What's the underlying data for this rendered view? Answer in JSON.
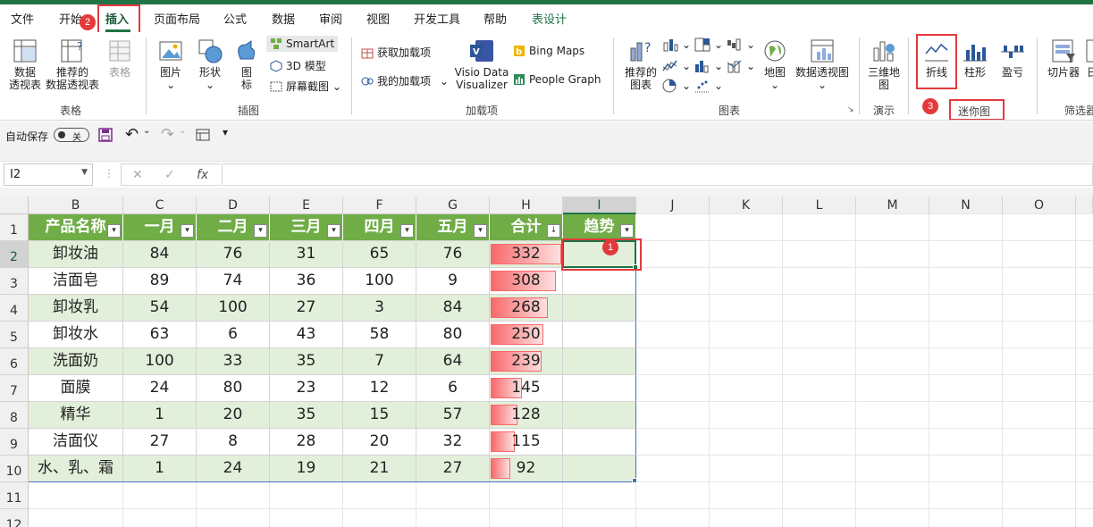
{
  "tabs": [
    "文件",
    "开始",
    "插入",
    "页面布局",
    "公式",
    "数据",
    "审阅",
    "视图",
    "开发工具",
    "帮助",
    "表设计"
  ],
  "active_tab": "插入",
  "ribbon": {
    "table_group": {
      "label": "表格",
      "pivot": "数据\n透视表",
      "pivot_l1": "数据",
      "pivot_l2": "透视表",
      "rec_l1": "推荐的",
      "rec_l2": "数据透视表",
      "table": "表格"
    },
    "illus_group": {
      "label": "插图",
      "pictures": "图片",
      "shapes": "形状",
      "icons_l1": "图",
      "icons_l2": "标",
      "smartart": "SmartArt",
      "model3d": "3D 模型",
      "screenshot": "屏幕截图"
    },
    "addins_group": {
      "label": "加载项",
      "get": "获取加载项",
      "my": "我的加载项",
      "visio_l1": "Visio Data",
      "visio_l2": "Visualizer",
      "bing": "Bing Maps",
      "people": "People Graph"
    },
    "charts_group": {
      "label": "图表",
      "rec_l1": "推荐的",
      "rec_l2": "图表",
      "map": "地图",
      "pivotchart": "数据透视图"
    },
    "tour_group": {
      "label": "演示",
      "map3d_l1": "三维地",
      "map3d_l2": "图"
    },
    "spark_group": {
      "label": "迷你图",
      "line": "折线",
      "column": "柱形",
      "winloss": "盈亏"
    },
    "filter_group": {
      "label": "筛选器",
      "slicer": "切片器",
      "timeline": "日"
    }
  },
  "qat": {
    "autosave": "自动保存",
    "toggle": "关"
  },
  "formula": {
    "namebox": "I2",
    "cancel": "✕",
    "enter": "✓",
    "fx": "fx",
    "value": ""
  },
  "columns": [
    "B",
    "C",
    "D",
    "E",
    "F",
    "G",
    "H",
    "I",
    "J",
    "K",
    "L",
    "M",
    "N",
    "O"
  ],
  "rows": [
    "1",
    "2",
    "3",
    "4",
    "5",
    "6",
    "7",
    "8",
    "9",
    "10",
    "11",
    "12"
  ],
  "table": {
    "headers": [
      "产品名称",
      "一月",
      "二月",
      "三月",
      "四月",
      "五月",
      "合计",
      "趋势"
    ],
    "rows": [
      [
        "卸妆油",
        "84",
        "76",
        "31",
        "65",
        "76",
        "332"
      ],
      [
        "洁面皂",
        "89",
        "74",
        "36",
        "100",
        "9",
        "308"
      ],
      [
        "卸妆乳",
        "54",
        "100",
        "27",
        "3",
        "84",
        "268"
      ],
      [
        "卸妆水",
        "63",
        "6",
        "43",
        "58",
        "80",
        "250"
      ],
      [
        "洗面奶",
        "100",
        "33",
        "35",
        "7",
        "64",
        "239"
      ],
      [
        "面膜",
        "24",
        "80",
        "23",
        "12",
        "6",
        "145"
      ],
      [
        "精华",
        "1",
        "20",
        "35",
        "15",
        "57",
        "128"
      ],
      [
        "洁面仪",
        "27",
        "8",
        "28",
        "20",
        "32",
        "115"
      ],
      [
        "水、乳、霜",
        "1",
        "24",
        "19",
        "21",
        "27",
        "92"
      ]
    ],
    "total_max": 332
  },
  "badges": {
    "one": "1",
    "two": "2",
    "three": "3"
  },
  "colors": {
    "excel_green": "#217346",
    "table_header": "#70ad47",
    "band": "#e2efda",
    "databar": "#f8696b",
    "highlight_red": "#e3393c"
  }
}
